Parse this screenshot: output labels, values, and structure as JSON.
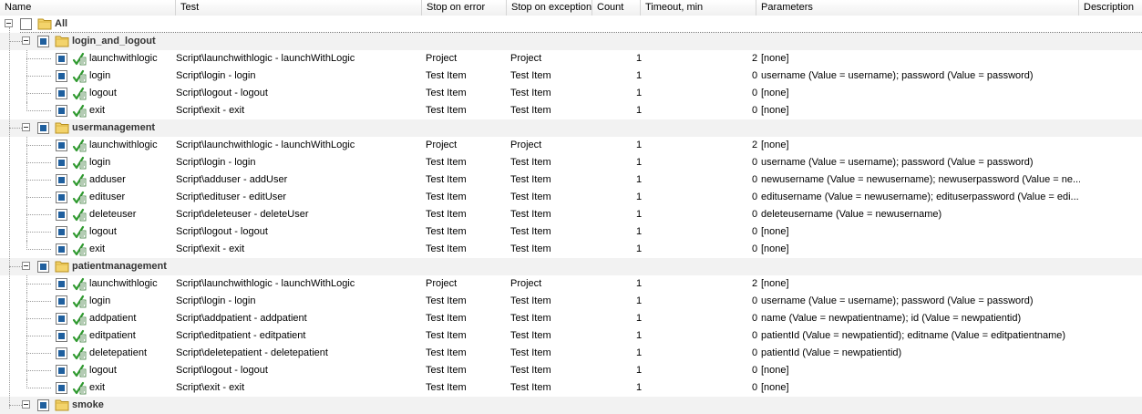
{
  "columns": {
    "name": "Name",
    "test": "Test",
    "stop_on_error": "Stop on error",
    "stop_on_exception": "Stop on exception",
    "count": "Count",
    "timeout": "Timeout, min",
    "parameters": "Parameters",
    "description": "Description"
  },
  "root": {
    "label": "All",
    "icon": "folder-icon"
  },
  "groups": [
    {
      "name": "login_and_logout",
      "items": [
        {
          "name": "launchwithlogic",
          "test": "Script\\launchwithlogic - launchWithLogic",
          "stop_on_error": "Project",
          "stop_on_exception": "Project",
          "count": "1",
          "timeout": "2",
          "parameters": "[none]"
        },
        {
          "name": "login",
          "test": "Script\\login - login",
          "stop_on_error": "Test Item",
          "stop_on_exception": "Test Item",
          "count": "1",
          "timeout": "0",
          "parameters": "username (Value = username); password (Value = password)"
        },
        {
          "name": "logout",
          "test": "Script\\logout - logout",
          "stop_on_error": "Test Item",
          "stop_on_exception": "Test Item",
          "count": "1",
          "timeout": "0",
          "parameters": "[none]"
        },
        {
          "name": "exit",
          "test": "Script\\exit - exit",
          "stop_on_error": "Test Item",
          "stop_on_exception": "Test Item",
          "count": "1",
          "timeout": "0",
          "parameters": "[none]"
        }
      ]
    },
    {
      "name": "usermanagement",
      "items": [
        {
          "name": "launchwithlogic",
          "test": "Script\\launchwithlogic - launchWithLogic",
          "stop_on_error": "Project",
          "stop_on_exception": "Project",
          "count": "1",
          "timeout": "2",
          "parameters": "[none]"
        },
        {
          "name": "login",
          "test": "Script\\login - login",
          "stop_on_error": "Test Item",
          "stop_on_exception": "Test Item",
          "count": "1",
          "timeout": "0",
          "parameters": "username (Value = username); password (Value = password)"
        },
        {
          "name": "adduser",
          "test": "Script\\adduser - addUser",
          "stop_on_error": "Test Item",
          "stop_on_exception": "Test Item",
          "count": "1",
          "timeout": "0",
          "parameters": "newusername (Value = newusername); newuserpassword (Value = ne..."
        },
        {
          "name": "edituser",
          "test": "Script\\edituser - editUser",
          "stop_on_error": "Test Item",
          "stop_on_exception": "Test Item",
          "count": "1",
          "timeout": "0",
          "parameters": "editusername (Value = newusername); edituserpassword (Value = edi..."
        },
        {
          "name": "deleteuser",
          "test": "Script\\deleteuser - deleteUser",
          "stop_on_error": "Test Item",
          "stop_on_exception": "Test Item",
          "count": "1",
          "timeout": "0",
          "parameters": "deleteusername (Value = newusername)"
        },
        {
          "name": "logout",
          "test": "Script\\logout - logout",
          "stop_on_error": "Test Item",
          "stop_on_exception": "Test Item",
          "count": "1",
          "timeout": "0",
          "parameters": "[none]"
        },
        {
          "name": "exit",
          "test": "Script\\exit - exit",
          "stop_on_error": "Test Item",
          "stop_on_exception": "Test Item",
          "count": "1",
          "timeout": "0",
          "parameters": "[none]"
        }
      ]
    },
    {
      "name": "patientmanagement",
      "items": [
        {
          "name": "launchwithlogic",
          "test": "Script\\launchwithlogic - launchWithLogic",
          "stop_on_error": "Project",
          "stop_on_exception": "Project",
          "count": "1",
          "timeout": "2",
          "parameters": "[none]"
        },
        {
          "name": "login",
          "test": "Script\\login - login",
          "stop_on_error": "Test Item",
          "stop_on_exception": "Test Item",
          "count": "1",
          "timeout": "0",
          "parameters": "username (Value = username); password (Value = password)"
        },
        {
          "name": "addpatient",
          "test": "Script\\addpatient - addpatient",
          "stop_on_error": "Test Item",
          "stop_on_exception": "Test Item",
          "count": "1",
          "timeout": "0",
          "parameters": "name (Value = newpatientname); id (Value = newpatientid)"
        },
        {
          "name": "editpatient",
          "test": "Script\\editpatient - editpatient",
          "stop_on_error": "Test Item",
          "stop_on_exception": "Test Item",
          "count": "1",
          "timeout": "0",
          "parameters": "patientId (Value = newpatientid); editname (Value = editpatientname)"
        },
        {
          "name": "deletepatient",
          "test": "Script\\deletepatient - deletepatient",
          "stop_on_error": "Test Item",
          "stop_on_exception": "Test Item",
          "count": "1",
          "timeout": "0",
          "parameters": "patientId (Value = newpatientid)"
        },
        {
          "name": "logout",
          "test": "Script\\logout - logout",
          "stop_on_error": "Test Item",
          "stop_on_exception": "Test Item",
          "count": "1",
          "timeout": "0",
          "parameters": "[none]"
        },
        {
          "name": "exit",
          "test": "Script\\exit - exit",
          "stop_on_error": "Test Item",
          "stop_on_exception": "Test Item",
          "count": "1",
          "timeout": "0",
          "parameters": "[none]"
        }
      ]
    },
    {
      "name": "smoke",
      "items": []
    }
  ],
  "colors": {
    "group_bg": "#f2f2f2",
    "checkbox_fill": "#1f5f9e",
    "folder": "#f3d36b"
  }
}
